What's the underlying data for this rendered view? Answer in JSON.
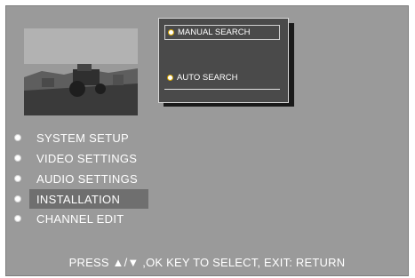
{
  "popup": {
    "items": [
      {
        "label": "MANUAL SEARCH"
      },
      {
        "label": "AUTO SEARCH"
      }
    ]
  },
  "menu": {
    "items": [
      {
        "label": "SYSTEM SETUP"
      },
      {
        "label": "VIDEO SETTINGS"
      },
      {
        "label": "AUDIO SETTINGS"
      },
      {
        "label": "INSTALLATION"
      },
      {
        "label": "CHANNEL EDIT"
      }
    ]
  },
  "footer": {
    "hint": "PRESS ▲/▼ ,OK KEY TO SELECT, EXIT: RETURN"
  }
}
